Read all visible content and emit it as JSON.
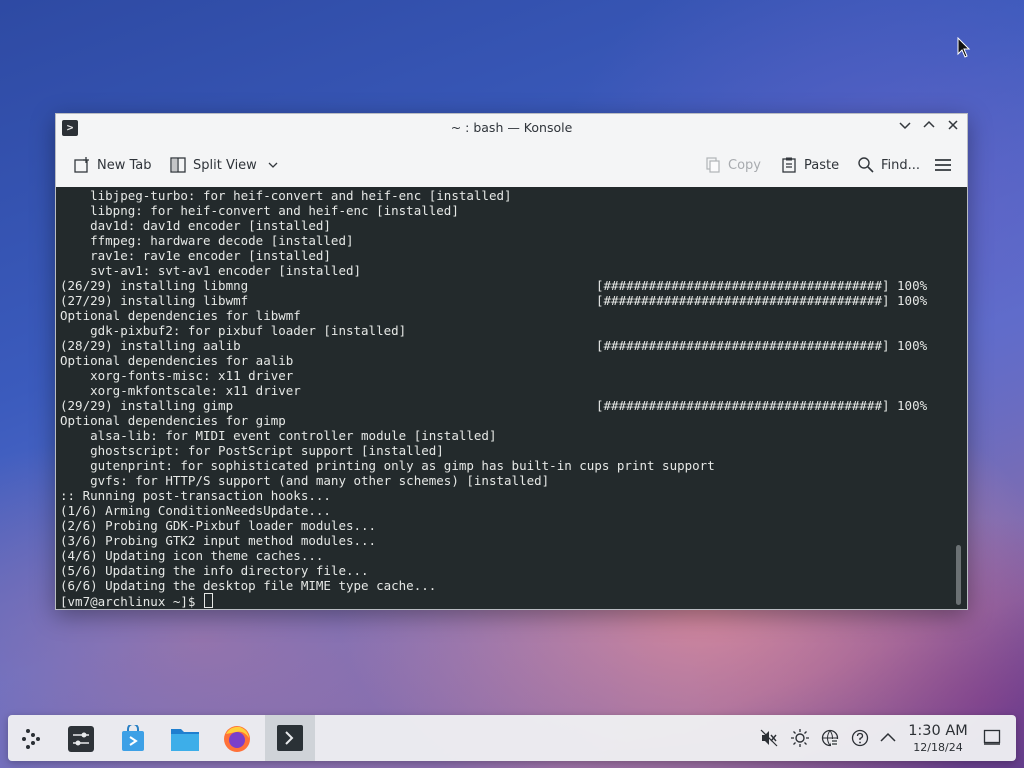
{
  "window": {
    "title": "~ : bash — Konsole"
  },
  "toolbar": {
    "new_tab": "New Tab",
    "split_view": "Split View",
    "copy": "Copy",
    "paste": "Paste",
    "find": "Find..."
  },
  "terminal": {
    "lines": [
      {
        "text": "    libjpeg-turbo: for heif-convert and heif-enc [installed]",
        "prog": ""
      },
      {
        "text": "    libpng: for heif-convert and heif-enc [installed]",
        "prog": ""
      },
      {
        "text": "    dav1d: dav1d encoder [installed]",
        "prog": ""
      },
      {
        "text": "    ffmpeg: hardware decode [installed]",
        "prog": ""
      },
      {
        "text": "    rav1e: rav1e encoder [installed]",
        "prog": ""
      },
      {
        "text": "    svt-av1: svt-av1 encoder [installed]",
        "prog": ""
      },
      {
        "text": "(26/29) installing libmng",
        "prog": "[#####################################] 100%"
      },
      {
        "text": "(27/29) installing libwmf",
        "prog": "[#####################################] 100%"
      },
      {
        "text": "Optional dependencies for libwmf",
        "prog": ""
      },
      {
        "text": "    gdk-pixbuf2: for pixbuf loader [installed]",
        "prog": ""
      },
      {
        "text": "(28/29) installing aalib",
        "prog": "[#####################################] 100%"
      },
      {
        "text": "Optional dependencies for aalib",
        "prog": ""
      },
      {
        "text": "    xorg-fonts-misc: x11 driver",
        "prog": ""
      },
      {
        "text": "    xorg-mkfontscale: x11 driver",
        "prog": ""
      },
      {
        "text": "(29/29) installing gimp",
        "prog": "[#####################################] 100%"
      },
      {
        "text": "Optional dependencies for gimp",
        "prog": ""
      },
      {
        "text": "    alsa-lib: for MIDI event controller module [installed]",
        "prog": ""
      },
      {
        "text": "    ghostscript: for PostScript support [installed]",
        "prog": ""
      },
      {
        "text": "    gutenprint: for sophisticated printing only as gimp has built-in cups print support",
        "prog": ""
      },
      {
        "text": "    gvfs: for HTTP/S support (and many other schemes) [installed]",
        "prog": ""
      },
      {
        "text": ":: Running post-transaction hooks...",
        "prog": ""
      },
      {
        "text": "(1/6) Arming ConditionNeedsUpdate...",
        "prog": ""
      },
      {
        "text": "(2/6) Probing GDK-Pixbuf loader modules...",
        "prog": ""
      },
      {
        "text": "(3/6) Probing GTK2 input method modules...",
        "prog": ""
      },
      {
        "text": "(4/6) Updating icon theme caches...",
        "prog": ""
      },
      {
        "text": "(5/6) Updating the info directory file...",
        "prog": ""
      },
      {
        "text": "(6/6) Updating the desktop file MIME type cache...",
        "prog": ""
      }
    ],
    "prompt": "[vm7@archlinux ~]$ "
  },
  "taskbar": {
    "apps": [
      {
        "name": "application-launcher-icon"
      },
      {
        "name": "system-settings-icon"
      },
      {
        "name": "discover-store-icon"
      },
      {
        "name": "file-manager-icon"
      },
      {
        "name": "firefox-icon"
      },
      {
        "name": "konsole-icon"
      }
    ],
    "tray": [
      "volume-muted-icon",
      "brightness-icon",
      "network-icon",
      "help-icon",
      "show-hidden-icons-icon"
    ],
    "clock": {
      "time": "1:30 AM",
      "date": "12/18/24"
    }
  },
  "colors": {
    "terminal_bg": "#232a2c",
    "terminal_fg": "#e6e8e6",
    "toolbar_bg": "#f4f5f6"
  }
}
